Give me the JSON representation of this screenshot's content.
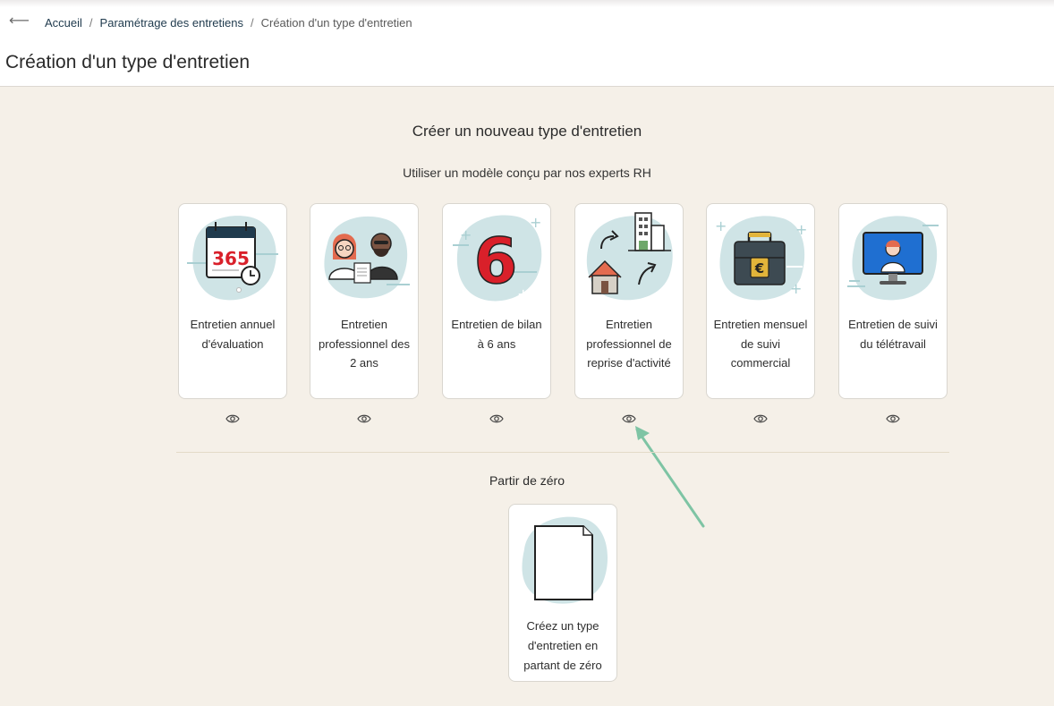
{
  "breadcrumb": {
    "back_icon": "arrow-left-icon",
    "items": [
      "Accueil",
      "Paramétrage des entretiens"
    ],
    "current": "Création d'un type d'entretien"
  },
  "page_title": "Création d'un type d'entretien",
  "main": {
    "title": "Créer un nouveau type d'entretien",
    "subtitle": "Utiliser un modèle conçu par nos experts RH",
    "templates": [
      {
        "label": "Entretien annuel d'évaluation",
        "icon": "calendar-365-icon",
        "preview_icon": "eye-icon"
      },
      {
        "label": "Entretien professionnel des 2 ans",
        "icon": "two-people-icon",
        "preview_icon": "eye-icon"
      },
      {
        "label": "Entretien de bilan à 6 ans",
        "icon": "number-six-icon",
        "preview_icon": "eye-icon"
      },
      {
        "label": "Entretien professionnel de reprise d'activité",
        "icon": "house-building-icon",
        "preview_icon": "eye-icon"
      },
      {
        "label": "Entretien mensuel de suivi commercial",
        "icon": "briefcase-euro-icon",
        "preview_icon": "eye-icon"
      },
      {
        "label": "Entretien de suivi du télétravail",
        "icon": "monitor-person-icon",
        "preview_icon": "eye-icon"
      }
    ],
    "from_scratch": {
      "title": "Partir de zéro",
      "label": "Créez un type d'entretien en partant de zéro",
      "icon": "blank-document-icon"
    }
  },
  "colors": {
    "background": "#f5f0e8",
    "blob": "#cfe4e6",
    "accent_arrow": "#7ec4a4",
    "red": "#d9202a"
  }
}
